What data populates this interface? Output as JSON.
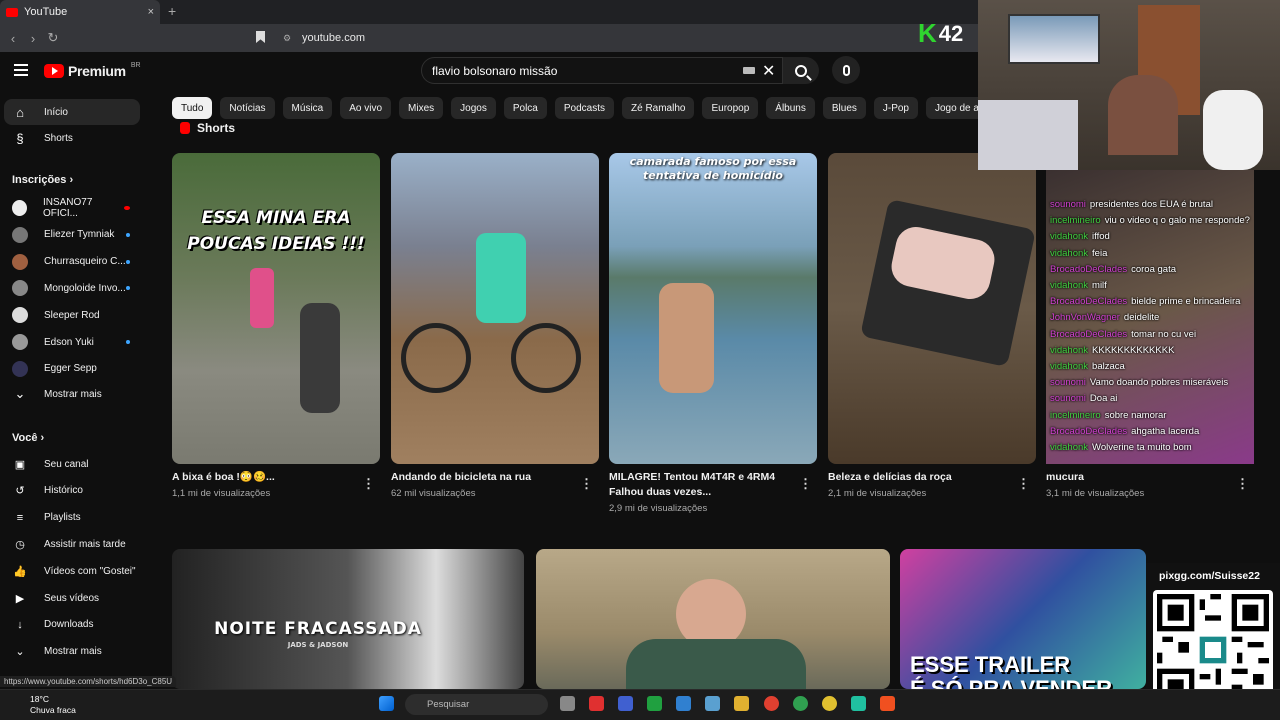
{
  "browser": {
    "tab_title": "YouTube",
    "tab_close": "×",
    "new_tab": "+",
    "url": "youtube.com"
  },
  "header": {
    "logo": "Premium",
    "logo_sup": "BR",
    "search_value": "flavio bolsonaro missão",
    "clear": "✕"
  },
  "chips": [
    "Tudo",
    "Notícias",
    "Música",
    "Ao vivo",
    "Mixes",
    "Jogos",
    "Polca",
    "Podcasts",
    "Zé Ramalho",
    "Europop",
    "Álbuns",
    "Blues",
    "J-Pop",
    "Jogo de ação e aventura"
  ],
  "sidebar": {
    "home": "Início",
    "shorts": "Shorts",
    "subs_header": "Inscrições",
    "subs": [
      {
        "name": "INSANO77 OFICI...",
        "live": true
      },
      {
        "name": "Eliezer Tymniak",
        "dot": true
      },
      {
        "name": "Churrasqueiro C...",
        "dot": true
      },
      {
        "name": "Mongoloide Invo...",
        "dot": true
      },
      {
        "name": "Sleeper Rod"
      },
      {
        "name": "Edson Yuki",
        "dot": true
      },
      {
        "name": "Egger Sepp"
      }
    ],
    "show_more": "Mostrar mais",
    "you_header": "Você",
    "you": [
      "Seu canal",
      "Histórico",
      "Playlists",
      "Assistir mais tarde",
      "Vídeos com \"Gostei\"",
      "Seus vídeos",
      "Downloads",
      "Mostrar mais"
    ]
  },
  "shorts_section": {
    "title": "Shorts",
    "items": [
      {
        "title": "A bixa é boa !😳🥴...",
        "views": "1,1 mi de visualizações",
        "caption": "ESSA MINA ERA POUCAS IDEIAS !!!"
      },
      {
        "title": "Andando de bicicleta na rua",
        "views": "62 mil visualizações"
      },
      {
        "title": "MILAGRE! Tentou M4T4R e 4RM4 Falhou duas vezes...",
        "views": "2,9 mi de visualizações",
        "caption": "camarada famoso por essa tentativa de homicídio"
      },
      {
        "title": "Beleza e delícias da roça",
        "views": "2,1 mi de visualizações"
      },
      {
        "title": "mucura",
        "views": "3,1 mi de visualizações"
      }
    ]
  },
  "row2": {
    "v1_caption": "NOITE FRACASSADA",
    "v1_sub": "JADS & JADSON",
    "v3_caption": "ESSE TRAILER",
    "v3_caption2": "É SÓ PRA VENDER"
  },
  "overlay": {
    "k_count": "42",
    "chat": [
      {
        "u": "sounomi",
        "m": "presidentes dos EUA é brutal"
      },
      {
        "u": "incelmineiro",
        "m": "viu o video q o galo me responde?"
      },
      {
        "u": "vidahonk",
        "m": "iffod"
      },
      {
        "u": "vidahonk",
        "m": "feia"
      },
      {
        "u": "BrocadoDeClades",
        "m": "coroa gata"
      },
      {
        "u": "vidahonk",
        "m": "milf"
      },
      {
        "u": "BrocadoDeClades",
        "m": "bielde prime e brincadeira"
      },
      {
        "u": "JohnVonWagner",
        "m": "deidelite"
      },
      {
        "u": "BrocadoDeClades",
        "m": "tomar no cu vei"
      },
      {
        "u": "vidahonk",
        "m": "KKKKKKKKKKKKK"
      },
      {
        "u": "vidahonk",
        "m": "balzaca"
      },
      {
        "u": "sounomi",
        "m": "Vamo doando pobres miseráveis"
      },
      {
        "u": "sounomi",
        "m": "Doa ai"
      },
      {
        "u": "incelmineiro",
        "m": "sobre namorar"
      },
      {
        "u": "BrocadoDeClades",
        "m": "ahgatha lacerda"
      },
      {
        "u": "vidahonk",
        "m": "Wolverine ta muito bom"
      }
    ],
    "pix": "pixgg.com/Suisse22"
  },
  "status_url": "https://www.youtube.com/shorts/hd6D3o_C85U",
  "taskbar": {
    "temp": "18°C",
    "weather": "Chuva fraca",
    "search": "Pesquisar"
  }
}
